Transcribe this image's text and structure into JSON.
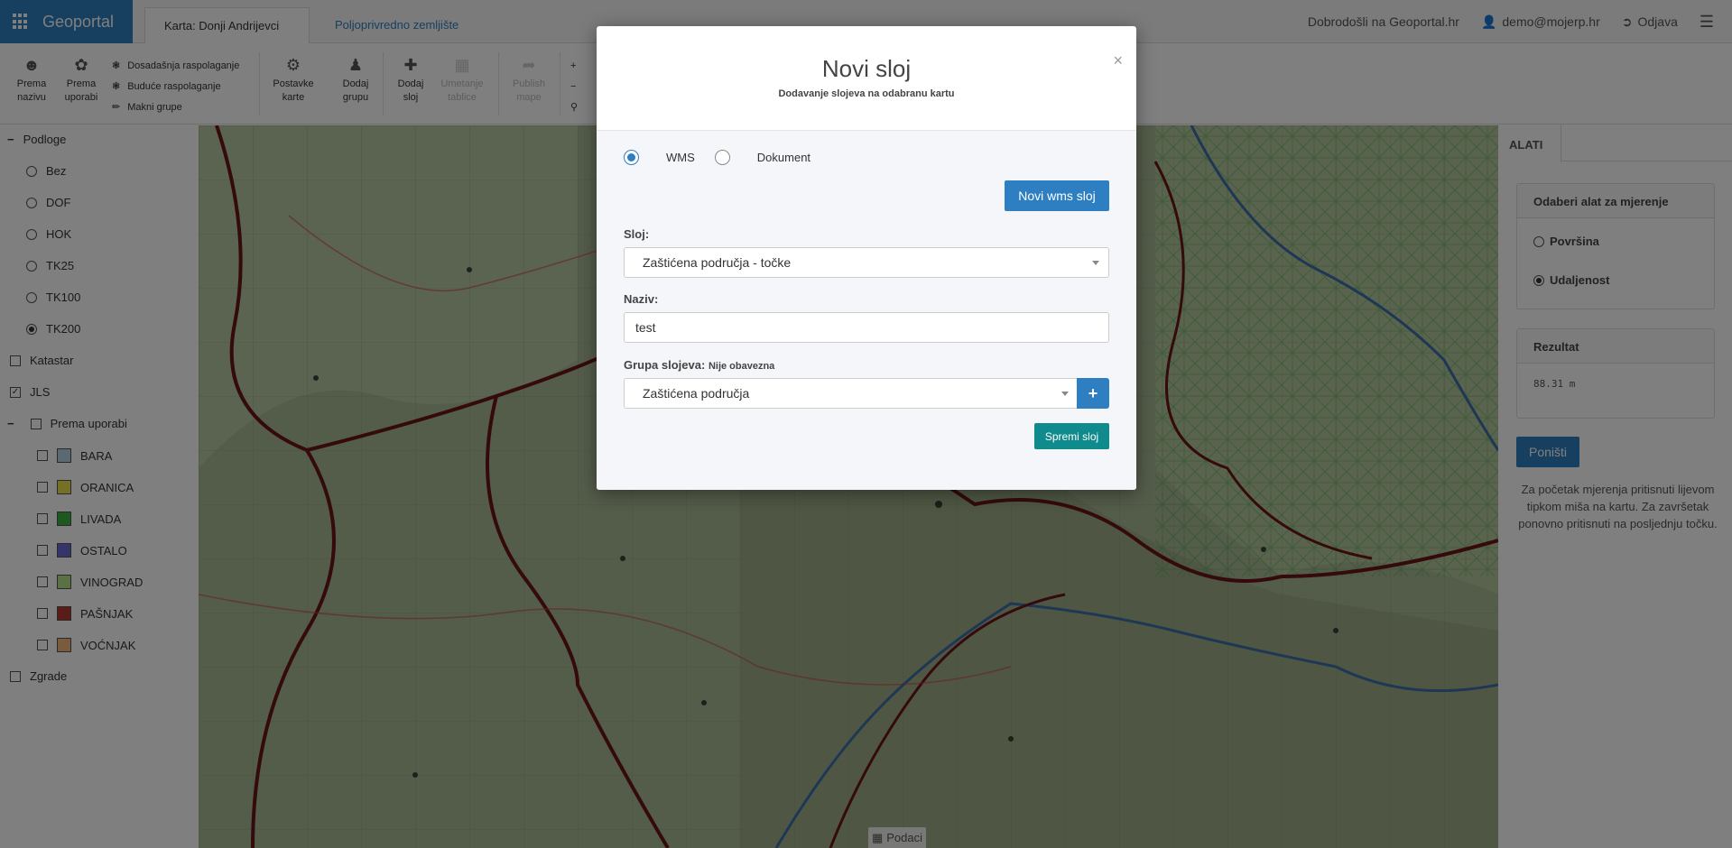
{
  "brand": {
    "name": "Geoportal"
  },
  "tabs": [
    {
      "label": "Karta: Donji Andrijevci"
    },
    {
      "label": "Poljoprivredno zemljište"
    }
  ],
  "topright": {
    "welcome": "Dobrodošli na Geoportal.hr",
    "user": "demo@mojerp.hr",
    "logout": "Odjava"
  },
  "toolbar": {
    "prema_nazivu": "Prema nazivu",
    "prema_uporabi": "Prema uporabi",
    "dosadasnja": "Dosadašnja raspolaganje",
    "buduca": "Buduće raspolaganje",
    "makni": "Makni grupe",
    "postavke": "Postavke karte",
    "dodaj_grupu": "Dodaj grupu",
    "dodaj_sloj": "Dodaj sloj",
    "umetanje": "Umetanje tablice",
    "publish": "Publish mape"
  },
  "sidebar": {
    "podloge": "Podloge",
    "bases": [
      "Bez",
      "DOF",
      "HOK",
      "TK25",
      "TK100",
      "TK200"
    ],
    "katastar": "Katastar",
    "jls": "JLS",
    "prema_uporabi": "Prema uporabi",
    "uses": [
      {
        "label": "BARA",
        "color": "#b7d3e0"
      },
      {
        "label": "ORANICA",
        "color": "#e8e04a"
      },
      {
        "label": "LIVADA",
        "color": "#3cb043"
      },
      {
        "label": "OSTALO",
        "color": "#6a6ad8"
      },
      {
        "label": "VINOGRAD",
        "color": "#b7e08a"
      },
      {
        "label": "PAŠNJAK",
        "color": "#b5382c"
      },
      {
        "label": "VOĆNJAK",
        "color": "#f2b77a"
      }
    ],
    "zgrade": "Zgrade"
  },
  "rightpanel": {
    "tab": "ALATI",
    "measure_title": "Odaberi alat za mjerenje",
    "opt1": "Površina",
    "opt2": "Udaljenost",
    "result_title": "Rezultat",
    "result_value": "88.31 m",
    "cancel": "Poništi",
    "help": "Za početak mjerenja pritisnuti lijevom tipkom miša na kartu. Za završetak ponovno pritisnuti na posljednju točku."
  },
  "map": {
    "data_button": "Podaci"
  },
  "modal": {
    "title": "Novi sloj",
    "subtitle": "Dodavanje slojeva na odabranu kartu",
    "radio_wms": "WMS",
    "radio_doc": "Dokument",
    "new_wms_btn": "Novi wms sloj",
    "sloj_label": "Sloj:",
    "sloj_value": "Zaštićena područja - točke",
    "naziv_label": "Naziv:",
    "naziv_value": "test",
    "grupa_label": "Grupa slojeva:",
    "grupa_hint": "Nije obavezna",
    "grupa_value": "Zaštićena područja",
    "save_btn": "Spremi sloj"
  },
  "colors": {
    "primary": "#2d7fc1",
    "teal": "#0f8a8d",
    "route": "#6b1418"
  }
}
